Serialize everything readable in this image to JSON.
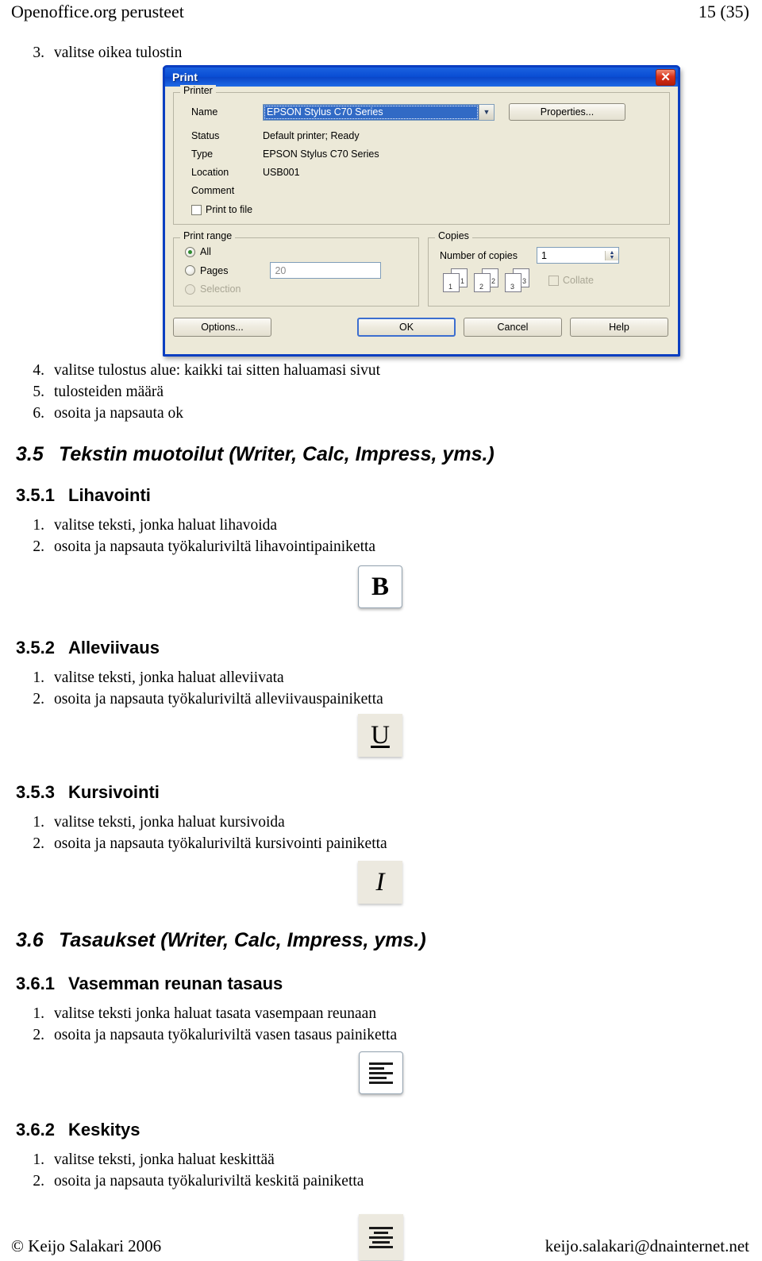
{
  "header": {
    "title": "Openoffice.org perusteet",
    "page_number": "15 (35)"
  },
  "intro_step": {
    "num": "3.",
    "text": "valitse oikea tulostin"
  },
  "print_dialog": {
    "title": "Print",
    "close_icon": "close-icon",
    "printer_group": {
      "legend": "Printer",
      "name_label": "Name",
      "name_value": "EPSON Stylus C70 Series",
      "properties_button": "Properties...",
      "status_label": "Status",
      "status_value": "Default printer; Ready",
      "type_label": "Type",
      "type_value": "EPSON Stylus C70 Series",
      "location_label": "Location",
      "location_value": "USB001",
      "comment_label": "Comment",
      "comment_value": "",
      "print_to_file_label": "Print to file",
      "print_to_file_checked": false
    },
    "print_range": {
      "legend": "Print range",
      "all_label": "All",
      "all_selected": true,
      "pages_label": "Pages",
      "pages_value": "20",
      "selection_label": "Selection",
      "selection_disabled": true
    },
    "copies": {
      "legend": "Copies",
      "number_label": "Number of copies",
      "number_value": "1",
      "collate_label": "Collate",
      "collate_disabled": true,
      "page_icons": [
        {
          "back": "1",
          "front": "1"
        },
        {
          "back": "2",
          "front": "2"
        },
        {
          "back": "3",
          "front": "3"
        }
      ]
    },
    "buttons": {
      "options": "Options...",
      "ok": "OK",
      "cancel": "Cancel",
      "help": "Help"
    }
  },
  "steps_after_dialog": [
    {
      "num": "4.",
      "text": "valitse tulostus alue: kaikki tai sitten haluamasi sivut"
    },
    {
      "num": "5.",
      "text": "tulosteiden määrä"
    },
    {
      "num": "6.",
      "text": "osoita ja napsauta ok"
    }
  ],
  "sections": [
    {
      "type": "h2",
      "number": "3.5",
      "title": "Tekstin muotoilut (Writer, Calc, Impress, yms.)"
    },
    {
      "type": "h3",
      "number": "3.5.1",
      "title": "Lihavointi",
      "steps": [
        {
          "num": "1.",
          "text": "valitse teksti, jonka haluat lihavoida"
        },
        {
          "num": "2.",
          "text": "osoita ja napsauta työkaluriviltä lihavointipainiketta"
        }
      ],
      "icon": {
        "name": "bold-icon",
        "glyph": "B",
        "style": "raised"
      }
    },
    {
      "type": "h3",
      "number": "3.5.2",
      "title": "Alleviivaus",
      "steps": [
        {
          "num": "1.",
          "text": "valitse teksti, jonka haluat alleviivata"
        },
        {
          "num": "2.",
          "text": "osoita ja napsauta työkaluriviltä alleviivauspainiketta"
        }
      ],
      "icon": {
        "name": "underline-icon",
        "glyph": "U",
        "style": "flat"
      }
    },
    {
      "type": "h3",
      "number": "3.5.3",
      "title": "Kursivointi",
      "steps": [
        {
          "num": "1.",
          "text": "valitse teksti, jonka haluat kursivoida"
        },
        {
          "num": "2.",
          "text": "osoita ja napsauta työkaluriviltä kursivointi painiketta"
        }
      ],
      "icon": {
        "name": "italic-icon",
        "glyph": "I",
        "style": "flat"
      }
    },
    {
      "type": "h2",
      "number": "3.6",
      "title": "Tasaukset (Writer, Calc, Impress, yms.)"
    },
    {
      "type": "h3",
      "number": "3.6.1",
      "title": "Vasemman reunan tasaus",
      "steps": [
        {
          "num": "1.",
          "text": "valitse teksti jonka haluat tasata vasempaan reunaan"
        },
        {
          "num": "2.",
          "text": "osoita ja napsauta työkaluriviltä vasen tasaus painiketta"
        }
      ],
      "icon": {
        "name": "align-left-icon",
        "glyph": "align-left",
        "style": "raised"
      }
    },
    {
      "type": "h3",
      "number": "3.6.2",
      "title": "Keskitys",
      "steps": [
        {
          "num": "1.",
          "text": "valitse teksti, jonka haluat keskittää"
        },
        {
          "num": "2.",
          "text": "osoita ja napsauta työkaluriviltä keskitä painiketta"
        }
      ],
      "icon": {
        "name": "align-center-icon",
        "glyph": "align-center",
        "style": "flat"
      }
    }
  ],
  "footer": {
    "copyright": "© Keijo Salakari 2006",
    "email": "keijo.salakari@dnainternet.net"
  }
}
